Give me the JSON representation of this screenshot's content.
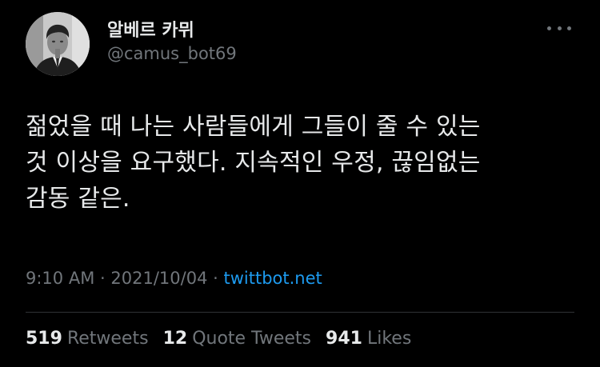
{
  "author": {
    "display_name": "알베르 카뮈",
    "handle": "@camus_bot69"
  },
  "tweet": {
    "lines": [
      "젊었을 때 나는 사람들에게 그들이 줄 수 있는",
      "것 이상을 요구했다. 지속적인 우정, 끊임없는",
      "감동 같은."
    ],
    "time": "9:10 AM",
    "separator1": "·",
    "date": "2021/10/04",
    "separator2": "·",
    "source": "twittbot.net"
  },
  "stats": {
    "retweets_count": "519",
    "retweets_label": "Retweets",
    "quotes_count": "12",
    "quotes_label": "Quote Tweets",
    "likes_count": "941",
    "likes_label": "Likes"
  },
  "icons": {
    "more": "more-options-icon",
    "avatar": "profile-photo"
  },
  "colors": {
    "background": "#000000",
    "text": "#e7e9ea",
    "secondary": "#71767b",
    "link": "#1d9bf0",
    "divider": "#2f3336"
  }
}
